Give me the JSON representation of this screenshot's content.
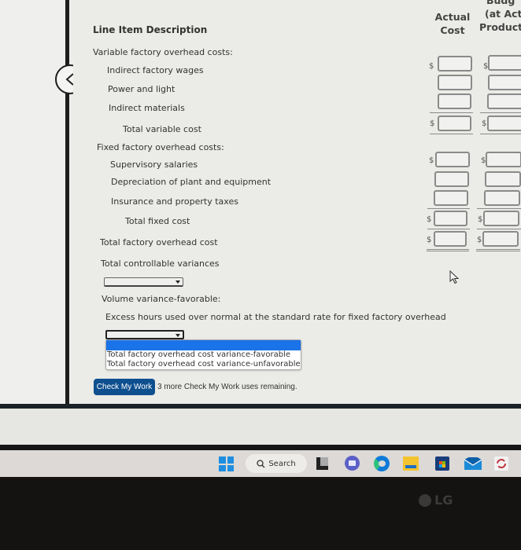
{
  "table": {
    "headers": {
      "line_item": "Line Item Description",
      "actual_cost": [
        "Actual",
        "Cost"
      ],
      "budget_partial": [
        "Budg",
        "(at Actu",
        "Producti"
      ]
    },
    "rows": [
      {
        "label": "Variable factory overhead costs:",
        "indent": 0
      },
      {
        "label": "Indirect factory wages",
        "indent": 1
      },
      {
        "label": "Power and light",
        "indent": 1
      },
      {
        "label": "Indirect materials",
        "indent": 1
      },
      {
        "label": "Total variable cost",
        "indent": 2
      },
      {
        "label": "Fixed factory overhead costs:",
        "indent": 0
      },
      {
        "label": "Supervisory salaries",
        "indent": 1
      },
      {
        "label": "Depreciation of plant and equipment",
        "indent": 1
      },
      {
        "label": "Insurance and property taxes",
        "indent": 1
      },
      {
        "label": "Total fixed cost",
        "indent": 2
      },
      {
        "label": "Total factory overhead cost",
        "indent": 0
      },
      {
        "label": "Total controllable variances",
        "indent": 0
      }
    ],
    "currency_symbol": "$",
    "actual_cost_values": [
      "",
      "",
      "",
      "",
      "",
      "",
      "",
      "",
      "",
      ""
    ],
    "budget_values": [
      "",
      "",
      "",
      "",
      "",
      "",
      "",
      "",
      "",
      ""
    ]
  },
  "controllable_select": {
    "value": ""
  },
  "volume": {
    "label": "Volume variance-favorable:",
    "sublabel": "Excess hours used over normal at the standard rate for fixed factory overhead"
  },
  "total_select": {
    "value": "",
    "options": [
      "",
      "Total factory overhead cost variance-favorable",
      "Total factory overhead cost variance-unfavorable"
    ]
  },
  "check": {
    "button_label": "Check My Work",
    "note": "3 more Check My Work uses remaining."
  },
  "taskbar": {
    "search_label": "Search",
    "icons": [
      "windows-start-icon",
      "search-icon",
      "task-view-icon",
      "teams-chat-icon",
      "edge-icon",
      "file-explorer-icon",
      "microsoft-store-icon",
      "mail-icon",
      "sync-app-icon"
    ]
  },
  "monitor": {
    "brand": "LG"
  },
  "colors": {
    "check_button": "#0e4f8f",
    "dropdown_highlight": "#1a73e8",
    "windows_blue": "#1f8ee0"
  }
}
